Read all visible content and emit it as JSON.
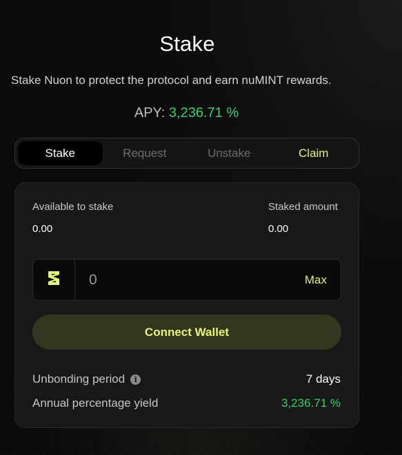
{
  "header": {
    "title": "Stake",
    "subtitle": "Stake Nuon to protect the protocol and earn nuMINT rewards.",
    "apy_label": "APY:",
    "apy_value": "3,236.71 %"
  },
  "tabs": [
    {
      "label": "Stake",
      "active": true
    },
    {
      "label": "Request",
      "active": false
    },
    {
      "label": "Unstake",
      "active": false
    },
    {
      "label": "Claim",
      "active": false
    }
  ],
  "card": {
    "available_label": "Available to stake",
    "available_value": "0.00",
    "staked_label": "Staked amount",
    "staked_value": "0.00",
    "input": {
      "placeholder": "0",
      "value": "",
      "token_icon": "nuon-logo-icon",
      "max_label": "Max"
    },
    "connect_label": "Connect Wallet",
    "unbonding_label": "Unbonding period",
    "unbonding_value": "7 days",
    "yield_label": "Annual percentage yield",
    "yield_value": "3,236.71 %"
  },
  "colors": {
    "accent_yellow": "#e3f27a",
    "apy_green": "#2fd26a",
    "background": "#0b0b0b",
    "card": "#181818",
    "button_bg": "#34361f"
  }
}
